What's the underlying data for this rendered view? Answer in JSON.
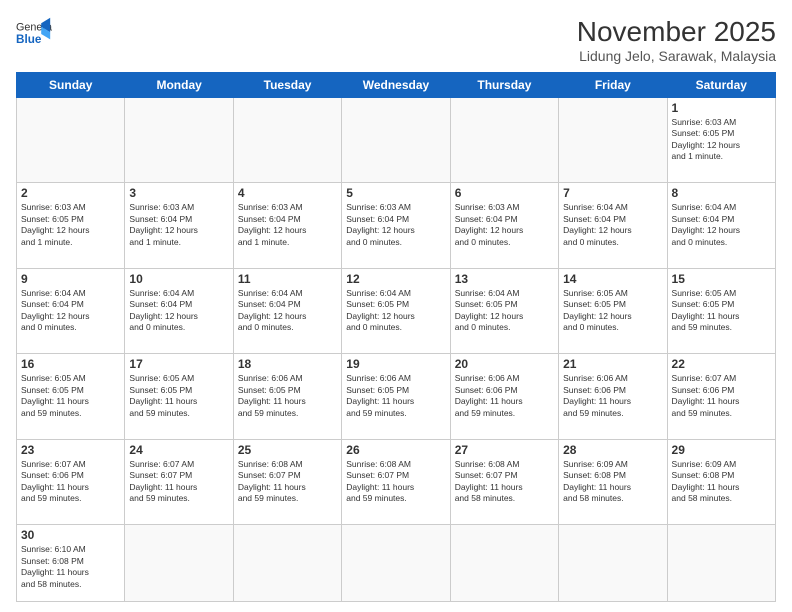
{
  "header": {
    "logo_general": "General",
    "logo_blue": "Blue",
    "month_title": "November 2025",
    "location": "Lidung Jelo, Sarawak, Malaysia"
  },
  "weekdays": [
    "Sunday",
    "Monday",
    "Tuesday",
    "Wednesday",
    "Thursday",
    "Friday",
    "Saturday"
  ],
  "weeks": [
    [
      {
        "day": "",
        "info": ""
      },
      {
        "day": "",
        "info": ""
      },
      {
        "day": "",
        "info": ""
      },
      {
        "day": "",
        "info": ""
      },
      {
        "day": "",
        "info": ""
      },
      {
        "day": "",
        "info": ""
      },
      {
        "day": "1",
        "info": "Sunrise: 6:03 AM\nSunset: 6:05 PM\nDaylight: 12 hours\nand 1 minute."
      }
    ],
    [
      {
        "day": "2",
        "info": "Sunrise: 6:03 AM\nSunset: 6:05 PM\nDaylight: 12 hours\nand 1 minute."
      },
      {
        "day": "3",
        "info": "Sunrise: 6:03 AM\nSunset: 6:04 PM\nDaylight: 12 hours\nand 1 minute."
      },
      {
        "day": "4",
        "info": "Sunrise: 6:03 AM\nSunset: 6:04 PM\nDaylight: 12 hours\nand 1 minute."
      },
      {
        "day": "5",
        "info": "Sunrise: 6:03 AM\nSunset: 6:04 PM\nDaylight: 12 hours\nand 0 minutes."
      },
      {
        "day": "6",
        "info": "Sunrise: 6:03 AM\nSunset: 6:04 PM\nDaylight: 12 hours\nand 0 minutes."
      },
      {
        "day": "7",
        "info": "Sunrise: 6:04 AM\nSunset: 6:04 PM\nDaylight: 12 hours\nand 0 minutes."
      },
      {
        "day": "8",
        "info": "Sunrise: 6:04 AM\nSunset: 6:04 PM\nDaylight: 12 hours\nand 0 minutes."
      }
    ],
    [
      {
        "day": "9",
        "info": "Sunrise: 6:04 AM\nSunset: 6:04 PM\nDaylight: 12 hours\nand 0 minutes."
      },
      {
        "day": "10",
        "info": "Sunrise: 6:04 AM\nSunset: 6:04 PM\nDaylight: 12 hours\nand 0 minutes."
      },
      {
        "day": "11",
        "info": "Sunrise: 6:04 AM\nSunset: 6:04 PM\nDaylight: 12 hours\nand 0 minutes."
      },
      {
        "day": "12",
        "info": "Sunrise: 6:04 AM\nSunset: 6:05 PM\nDaylight: 12 hours\nand 0 minutes."
      },
      {
        "day": "13",
        "info": "Sunrise: 6:04 AM\nSunset: 6:05 PM\nDaylight: 12 hours\nand 0 minutes."
      },
      {
        "day": "14",
        "info": "Sunrise: 6:05 AM\nSunset: 6:05 PM\nDaylight: 12 hours\nand 0 minutes."
      },
      {
        "day": "15",
        "info": "Sunrise: 6:05 AM\nSunset: 6:05 PM\nDaylight: 11 hours\nand 59 minutes."
      }
    ],
    [
      {
        "day": "16",
        "info": "Sunrise: 6:05 AM\nSunset: 6:05 PM\nDaylight: 11 hours\nand 59 minutes."
      },
      {
        "day": "17",
        "info": "Sunrise: 6:05 AM\nSunset: 6:05 PM\nDaylight: 11 hours\nand 59 minutes."
      },
      {
        "day": "18",
        "info": "Sunrise: 6:06 AM\nSunset: 6:05 PM\nDaylight: 11 hours\nand 59 minutes."
      },
      {
        "day": "19",
        "info": "Sunrise: 6:06 AM\nSunset: 6:05 PM\nDaylight: 11 hours\nand 59 minutes."
      },
      {
        "day": "20",
        "info": "Sunrise: 6:06 AM\nSunset: 6:06 PM\nDaylight: 11 hours\nand 59 minutes."
      },
      {
        "day": "21",
        "info": "Sunrise: 6:06 AM\nSunset: 6:06 PM\nDaylight: 11 hours\nand 59 minutes."
      },
      {
        "day": "22",
        "info": "Sunrise: 6:07 AM\nSunset: 6:06 PM\nDaylight: 11 hours\nand 59 minutes."
      }
    ],
    [
      {
        "day": "23",
        "info": "Sunrise: 6:07 AM\nSunset: 6:06 PM\nDaylight: 11 hours\nand 59 minutes."
      },
      {
        "day": "24",
        "info": "Sunrise: 6:07 AM\nSunset: 6:07 PM\nDaylight: 11 hours\nand 59 minutes."
      },
      {
        "day": "25",
        "info": "Sunrise: 6:08 AM\nSunset: 6:07 PM\nDaylight: 11 hours\nand 59 minutes."
      },
      {
        "day": "26",
        "info": "Sunrise: 6:08 AM\nSunset: 6:07 PM\nDaylight: 11 hours\nand 59 minutes."
      },
      {
        "day": "27",
        "info": "Sunrise: 6:08 AM\nSunset: 6:07 PM\nDaylight: 11 hours\nand 58 minutes."
      },
      {
        "day": "28",
        "info": "Sunrise: 6:09 AM\nSunset: 6:08 PM\nDaylight: 11 hours\nand 58 minutes."
      },
      {
        "day": "29",
        "info": "Sunrise: 6:09 AM\nSunset: 6:08 PM\nDaylight: 11 hours\nand 58 minutes."
      }
    ],
    [
      {
        "day": "30",
        "info": "Sunrise: 6:10 AM\nSunset: 6:08 PM\nDaylight: 11 hours\nand 58 minutes."
      },
      {
        "day": "",
        "info": ""
      },
      {
        "day": "",
        "info": ""
      },
      {
        "day": "",
        "info": ""
      },
      {
        "day": "",
        "info": ""
      },
      {
        "day": "",
        "info": ""
      },
      {
        "day": "",
        "info": ""
      }
    ]
  ]
}
